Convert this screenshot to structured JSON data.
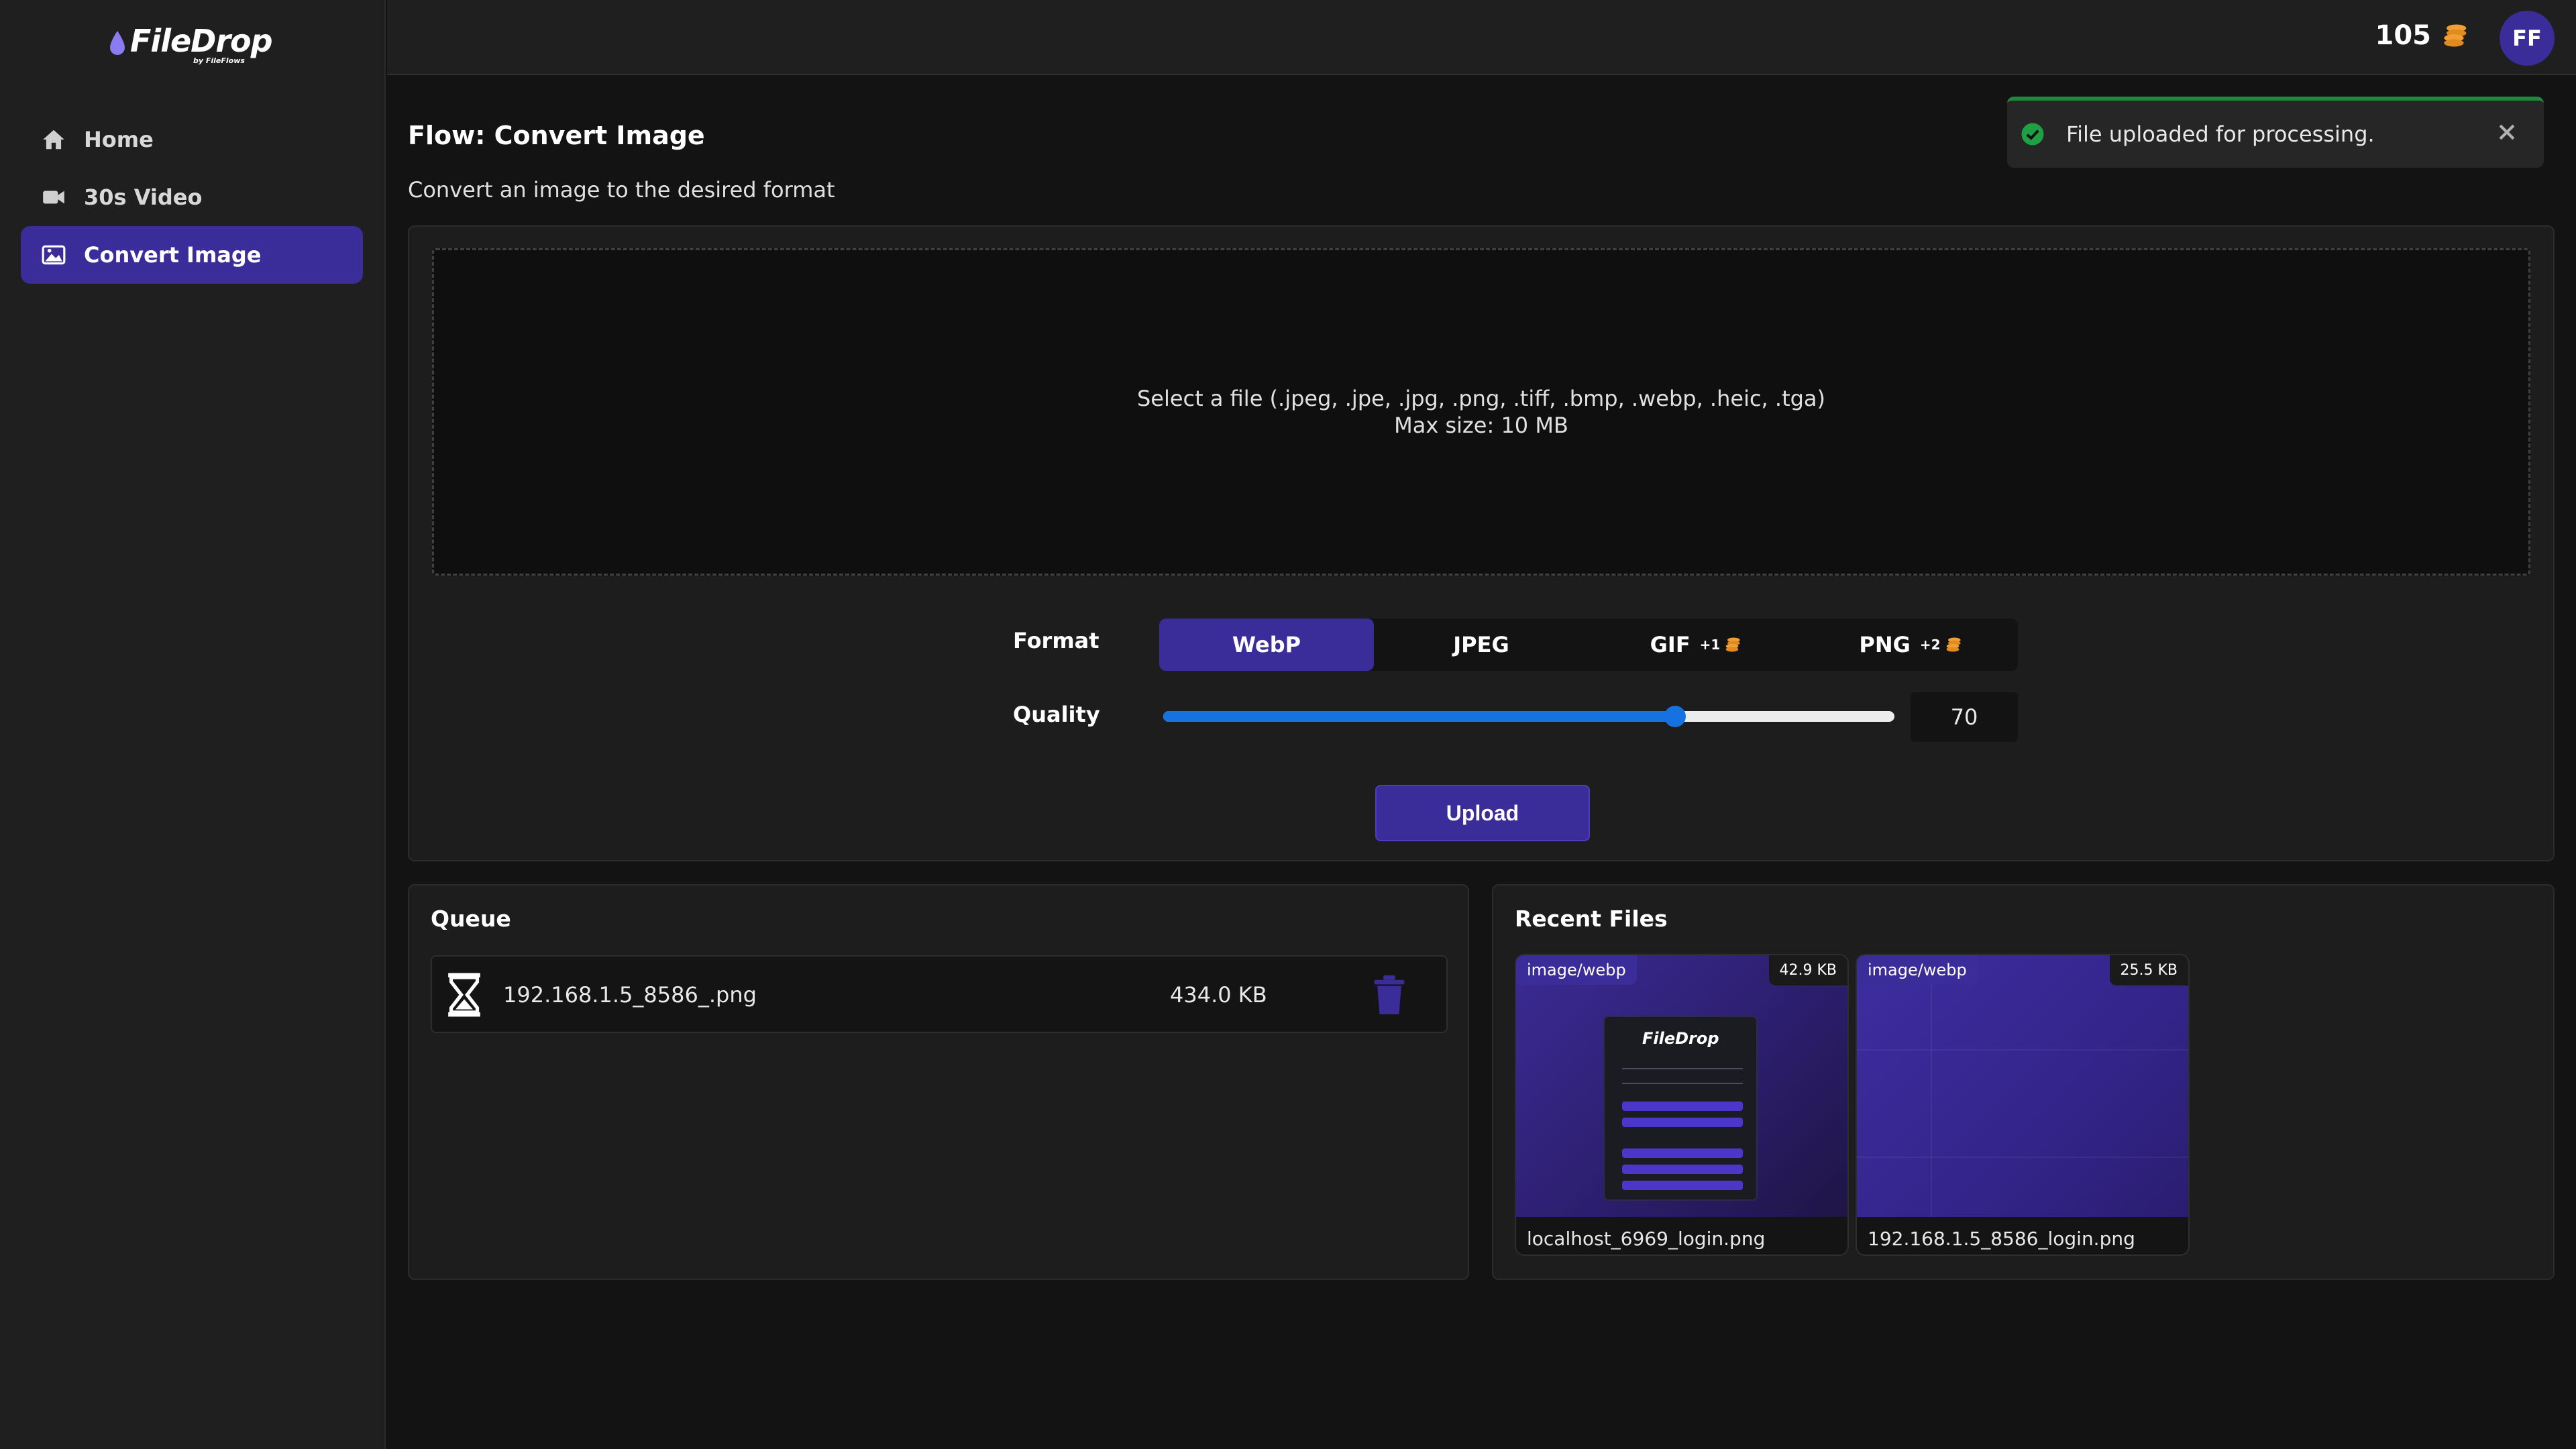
{
  "app": {
    "logo_text": "FileDrop",
    "logo_sub": "by FileFlows",
    "credits": "105",
    "avatar_initials": "FF",
    "accent_color": "#3a2c99"
  },
  "sidebar": {
    "items": [
      {
        "label": "Home",
        "icon": "home-icon"
      },
      {
        "label": "30s Video",
        "icon": "video-icon"
      },
      {
        "label": "Convert Image",
        "icon": "image-icon",
        "active": true
      }
    ]
  },
  "page": {
    "title": "Flow: Convert Image",
    "description": "Convert an image to the desired format"
  },
  "toast": {
    "message": "File uploaded for processing.",
    "status_color": "#1c8a3a"
  },
  "dropzone": {
    "line1": "Select a file (.jpeg, .jpe, .jpg, .png, .tiff, .bmp, .webp, .heic, .tga)",
    "line2": "Max size: 10 MB"
  },
  "form": {
    "format_label": "Format",
    "formats": [
      {
        "label": "WebP",
        "extra": "",
        "selected": true
      },
      {
        "label": "JPEG",
        "extra": ""
      },
      {
        "label": "GIF",
        "extra": "+1"
      },
      {
        "label": "PNG",
        "extra": "+2"
      }
    ],
    "quality_label": "Quality",
    "quality_value": "70",
    "quality_fraction": 0.7,
    "upload_label": "Upload"
  },
  "queue": {
    "title": "Queue",
    "items": [
      {
        "name": "192.168.1.5_8586_.png",
        "size": "434.0 KB"
      }
    ]
  },
  "recent": {
    "title": "Recent Files",
    "files": [
      {
        "mime": "image/webp",
        "size": "42.9 KB",
        "name": "localhost_6969_login.png"
      },
      {
        "mime": "image/webp",
        "size": "25.5 KB",
        "name": "192.168.1.5_8586_login.png"
      }
    ]
  }
}
